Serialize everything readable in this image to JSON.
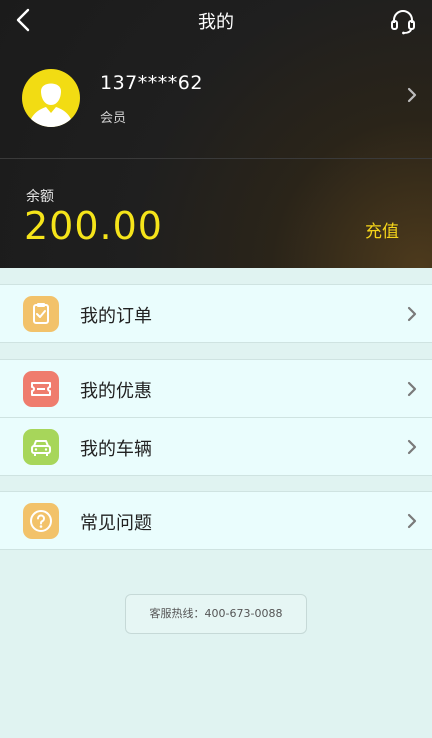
{
  "header": {
    "title": "我的"
  },
  "profile": {
    "phone": "137****62",
    "member_label": "会员"
  },
  "balance": {
    "label": "余额",
    "value": "200.00",
    "recharge_label": "充值"
  },
  "menu_groups": [
    {
      "items": [
        {
          "label": "我的订单",
          "icon": "clipboard-check-icon",
          "color": "#f2c26a"
        }
      ]
    },
    {
      "items": [
        {
          "label": "我的优惠",
          "icon": "ticket-icon",
          "color": "#ef7c6d"
        },
        {
          "label": "我的车辆",
          "icon": "car-icon",
          "color": "#a7d65a"
        }
      ]
    },
    {
      "items": [
        {
          "label": "常见问题",
          "icon": "question-icon",
          "color": "#f2c26a"
        }
      ]
    }
  ],
  "hotline": "客服热线：400-673-0088",
  "colors": {
    "accent_yellow": "#f5e41a",
    "background": "#e0f3f1",
    "header_dark": "#1e1e1e"
  }
}
